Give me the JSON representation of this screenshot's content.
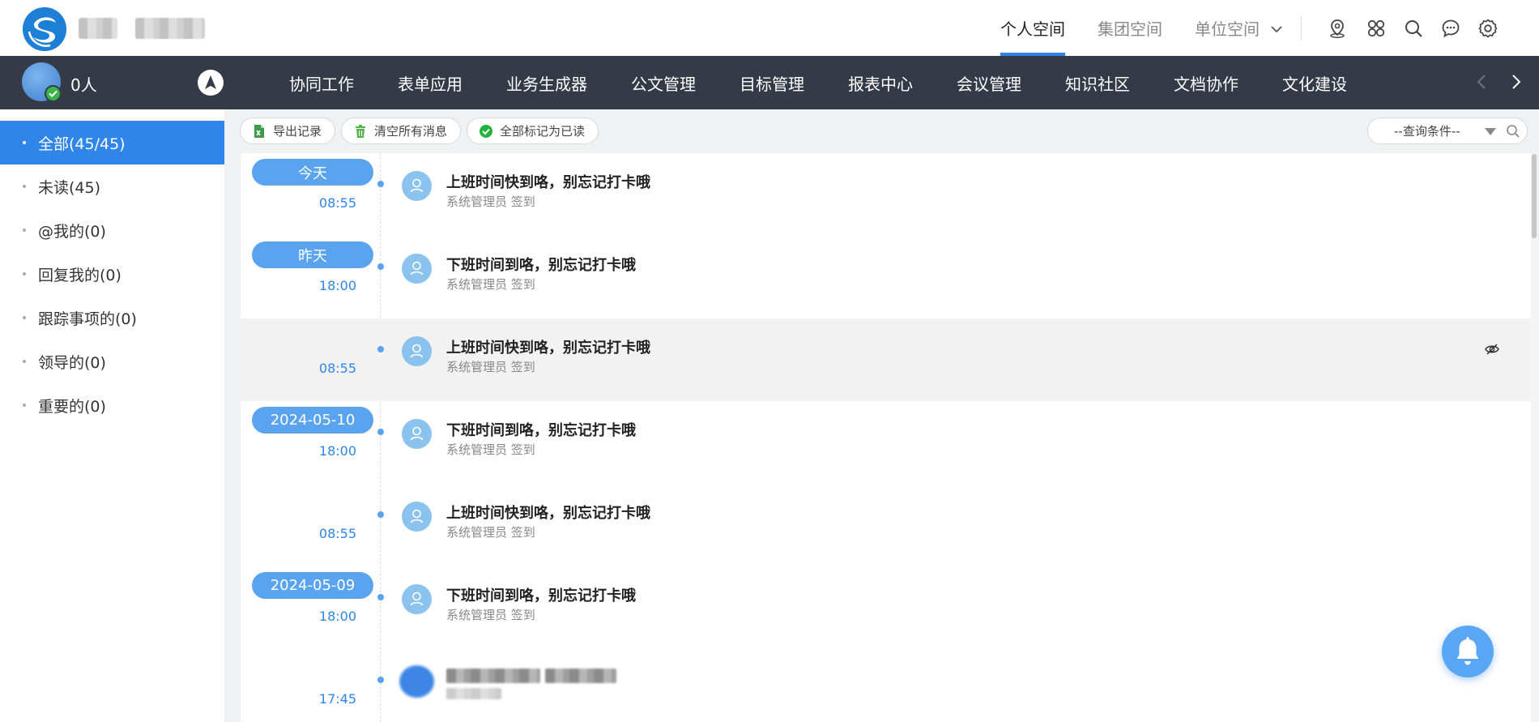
{
  "header": {
    "top_tabs": [
      {
        "label": "个人空间",
        "active": true
      },
      {
        "label": "集团空间",
        "active": false
      },
      {
        "label": "单位空间",
        "active": false
      }
    ],
    "icons": [
      "location-icon",
      "apps-icon",
      "search-icon",
      "chat-icon",
      "settings-icon"
    ]
  },
  "navbar": {
    "online_count": "0人",
    "items": [
      "协同工作",
      "表单应用",
      "业务生成器",
      "公文管理",
      "目标管理",
      "报表中心",
      "会议管理",
      "知识社区",
      "文档协作",
      "文化建设"
    ]
  },
  "sidebar": {
    "items": [
      {
        "label": "全部(45/45)",
        "active": true
      },
      {
        "label": "未读(45)",
        "active": false
      },
      {
        "label": "@我的(0)",
        "active": false
      },
      {
        "label": "回复我的(0)",
        "active": false
      },
      {
        "label": "跟踪事项的(0)",
        "active": false
      },
      {
        "label": "领导的(0)",
        "active": false
      },
      {
        "label": "重要的(0)",
        "active": false
      }
    ]
  },
  "toolbar": {
    "export_label": "导出记录",
    "clear_label": "清空所有消息",
    "mark_read_label": "全部标记为已读",
    "query_placeholder": "--查询条件--"
  },
  "messages": [
    {
      "date": "今天",
      "time": "08:55",
      "title": "上班时间快到咯，别忘记打卡哦",
      "sub": "系统管理员 签到"
    },
    {
      "date": "昨天",
      "time": "18:00",
      "title": "下班时间到咯，别忘记打卡哦",
      "sub": "系统管理员 签到"
    },
    {
      "date": "",
      "time": "08:55",
      "title": "上班时间快到咯，别忘记打卡哦",
      "sub": "系统管理员 签到"
    },
    {
      "date": "2024-05-10",
      "time": "18:00",
      "title": "下班时间到咯，别忘记打卡哦",
      "sub": "系统管理员 签到"
    },
    {
      "date": "",
      "time": "08:55",
      "title": "上班时间快到咯，别忘记打卡哦",
      "sub": "系统管理员 签到"
    },
    {
      "date": "2024-05-09",
      "time": "18:00",
      "title": "下班时间到咯，别忘记打卡哦",
      "sub": "系统管理员 签到"
    },
    {
      "date": "",
      "time": "17:45",
      "title": "",
      "sub": ""
    }
  ],
  "colors": {
    "accent": "#2f86e8",
    "nav_bg": "#343a46",
    "pill": "#5aa4ef",
    "check_green": "#3bb54a"
  }
}
